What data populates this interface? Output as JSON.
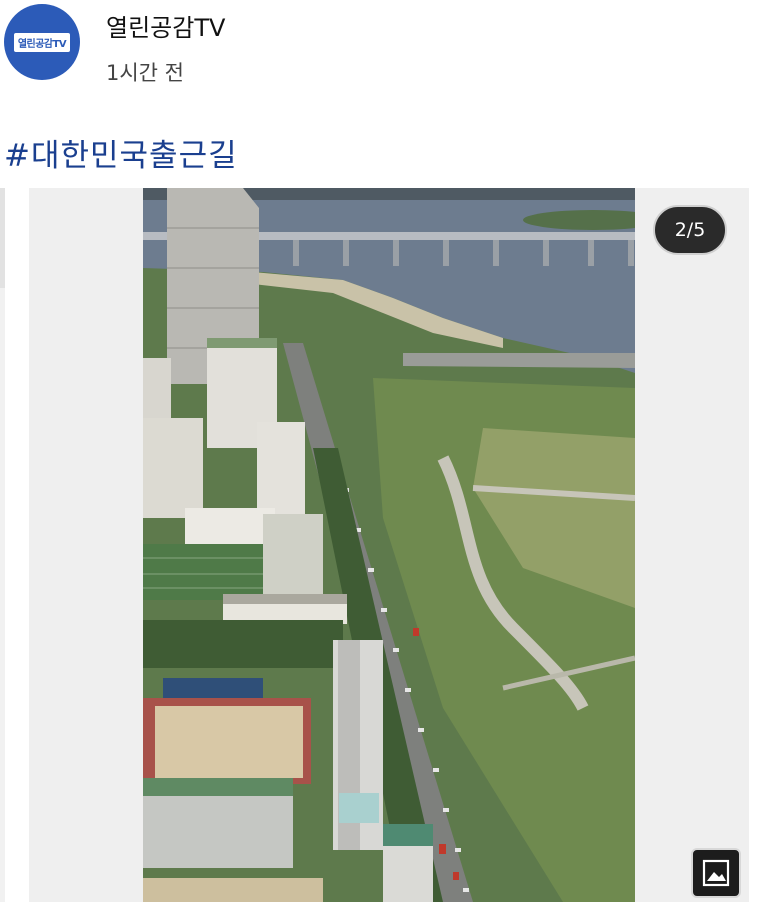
{
  "channel": {
    "avatar_text": "열린공감TV",
    "name": "열린공감TV",
    "time": "1시간 전"
  },
  "post": {
    "hashtag": "#대한민국출근길"
  },
  "carousel": {
    "counter": "2/5",
    "current": 2,
    "total": 5
  },
  "icons": {
    "gallery": "gallery-icon"
  }
}
